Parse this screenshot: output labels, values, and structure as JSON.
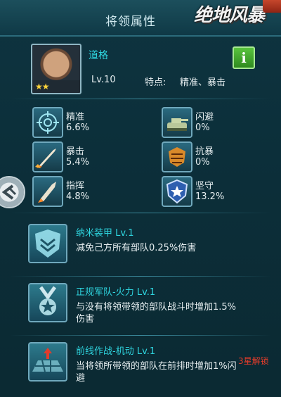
{
  "header": {
    "title": "将领属性",
    "brand": "绝地风暴"
  },
  "profile": {
    "name": "道格",
    "level": "Lv.10",
    "trait_label": "特点:",
    "trait_value": "精准、暴击",
    "stars": "★★",
    "info_label": "i"
  },
  "stats": [
    {
      "name": "精准",
      "value": "6.6%",
      "icon": "crosshair-icon"
    },
    {
      "name": "闪避",
      "value": "0%",
      "icon": "tank-icon"
    },
    {
      "name": "暴击",
      "value": "5.4%",
      "icon": "missile-icon"
    },
    {
      "name": "抗暴",
      "value": "0%",
      "icon": "shield-burst-icon"
    },
    {
      "name": "指挥",
      "value": "4.8%",
      "icon": "rocket-icon"
    },
    {
      "name": "坚守",
      "value": "13.2%",
      "icon": "star-shield-icon"
    }
  ],
  "skills": [
    {
      "title": "纳米装甲 Lv.1",
      "desc": "减免己方所有部队0.25%伤害",
      "icon": "armor-badge-icon"
    },
    {
      "title": "正规军队-火力 Lv.1",
      "desc": "与没有将领带领的部队战斗时增加1.5%伤害",
      "icon": "medal-icon"
    },
    {
      "title": "前线作战-机动 Lv.1",
      "desc": "当将领所带领的部队在前排时增加1%闪避",
      "icon": "frontline-icon"
    }
  ],
  "unlock_note": "3星解锁",
  "colors": {
    "accent": "#2fd6e0",
    "lock": "#e23c2b",
    "info_button": "#3fa82a"
  }
}
